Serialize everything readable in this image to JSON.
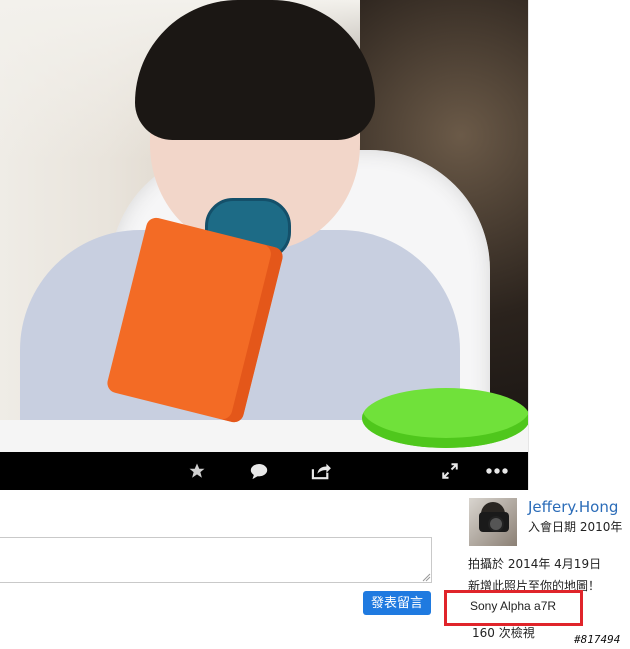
{
  "toolbar": {
    "icons": [
      "star-icon",
      "comment-icon",
      "share-icon",
      "expand-icon",
      "more-icon"
    ]
  },
  "comment": {
    "placeholder": "",
    "submit_label": "發表留言"
  },
  "author": {
    "name": "Jeffery.Hong",
    "joined": "入會日期 2010年"
  },
  "photo_info": {
    "shot_date": "拍攝於 2014年 4月19日",
    "add_to_map": "新增此照片至你的地圖！",
    "camera": "Sony Alpha a7R",
    "views": "160 次檢視"
  },
  "watermark": "#817494",
  "colors": {
    "accent": "#1f7ae0",
    "link": "#2b6cb8",
    "highlight_box": "#e0242a"
  }
}
